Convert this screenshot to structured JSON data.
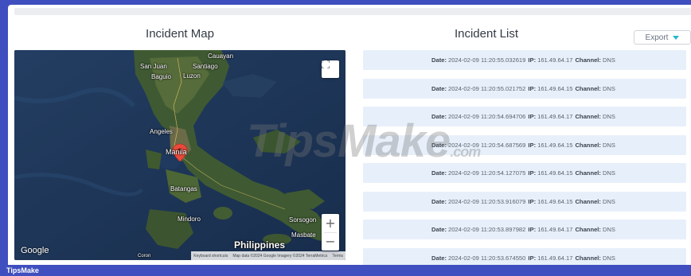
{
  "map_panel": {
    "title": "Incident Map"
  },
  "list_panel": {
    "title": "Incident List",
    "export_label": "Export"
  },
  "map": {
    "labels": {
      "cauayan": "Cauayan",
      "san_juan": "San Juan",
      "santiago": "Santiago",
      "baguio": "Baguio",
      "luzon": "Luzon",
      "angeles": "Angeles",
      "manila": "Manila",
      "batangas": "Batangas",
      "mindoro": "Mindoro",
      "sorsogon": "Sorsogon",
      "masbate": "Masbate",
      "philippines": "Philippines"
    },
    "google_logo": "Google",
    "coron": "Coron",
    "attribution": {
      "shortcuts": "Keyboard shortcuts",
      "map_data": "Map data ©2024 Google Imagery ©2024 TerraMetrics",
      "terms": "Terms"
    },
    "icons": {
      "fullscreen": "fullscreen-icon",
      "zoom_in": "+",
      "zoom_out": "−",
      "marker": "map-pin-icon"
    }
  },
  "field_labels": {
    "date": "Date:",
    "ip": "IP:",
    "channel": "Channel:"
  },
  "incidents": [
    {
      "date": "2024-02-09 11:20:55.032619",
      "ip": "161.49.64.17",
      "channel": "DNS"
    },
    {
      "date": "2024-02-09 11:20:55.021752",
      "ip": "161.49.64.15",
      "channel": "DNS"
    },
    {
      "date": "2024-02-09 11:20:54.694706",
      "ip": "161.49.64.17",
      "channel": "DNS"
    },
    {
      "date": "2024-02-09 11:20:54.687569",
      "ip": "161.49.64.15",
      "channel": "DNS"
    },
    {
      "date": "2024-02-09 11:20:54.127075",
      "ip": "161.49.64.15",
      "channel": "DNS"
    },
    {
      "date": "2024-02-09 11:20:53.916079",
      "ip": "161.49.64.15",
      "channel": "DNS"
    },
    {
      "date": "2024-02-09 11:20:53.897982",
      "ip": "161.49.64.17",
      "channel": "DNS"
    },
    {
      "date": "2024-02-09 11:20:53.674550",
      "ip": "161.49.64.17",
      "channel": "DNS"
    }
  ],
  "watermark": {
    "main": "TipsMake",
    "suffix": ".com"
  },
  "footer": {
    "brand": "TipsMake"
  },
  "colors": {
    "accent": "#3f4fbf",
    "row_bg": "#e7f0fa",
    "caret": "#28b7c9"
  }
}
